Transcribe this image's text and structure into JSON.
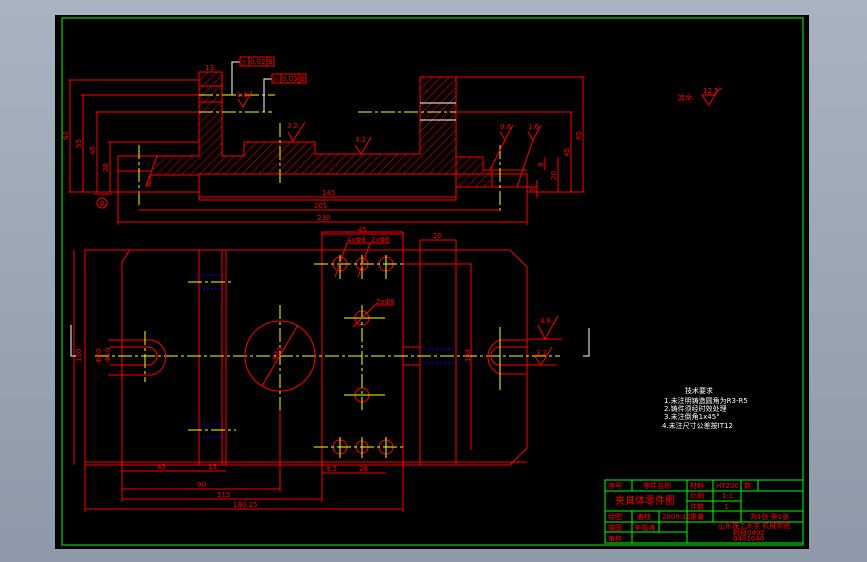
{
  "drawing": {
    "colors": {
      "outline": "#ff0000",
      "centerline": "#ffff00",
      "border": "#00ff00",
      "hidden": "#0000ff",
      "leader": "#ffffff",
      "background": "#000000"
    },
    "top_section": {
      "tolerance_1": {
        "symbol": "//",
        "value": "0.02",
        "datum": "B"
      },
      "tolerance_2": {
        "symbol": "//",
        "value": "0.03",
        "datum": "B"
      },
      "datum_label": "B",
      "dims": {
        "d13": "13",
        "d63": "63",
        "d55": "55",
        "d45": "45",
        "d28": "28",
        "d145": "145",
        "d205": "205",
        "d230": "230",
        "r65": "65",
        "r45": "45",
        "r20": "20",
        "r8": "8",
        "r3": "3"
      },
      "roughness": [
        "0.8",
        "3.2",
        "3.2",
        "0.8",
        "1.6"
      ]
    },
    "plan_view": {
      "dims": {
        "d45top": "45",
        "d20top": "20",
        "holes_4x8": "4xΦ8",
        "holes_2x6": "2xΦ6",
        "holes_2x8": "2xΦ8",
        "d130": "130",
        "d30": "Φ30",
        "d10": "Φ10",
        "d50": "Φ50",
        "d104": "104",
        "d45": "45",
        "d15": "15",
        "d90": "90",
        "d115": "115",
        "d180": "180.25",
        "d95": "9.5",
        "d26": "26"
      },
      "roughness": [
        "4.8",
        "3.2"
      ]
    },
    "general_roughness": {
      "label": "其余",
      "value": "12.5"
    },
    "requirements": {
      "title": "技术要求",
      "items": [
        "1.未注明铸造圆角为R3-R5",
        "2.铸件须经时效处理",
        "3.未注倒角1x45°",
        "4.未注尺寸公差按IT12"
      ]
    },
    "title_block": {
      "seq_label": "序号",
      "part_name_label": "零件名称",
      "material_label": "材料",
      "material": "HT200",
      "qty_short": "数",
      "drawing_name": "夹具体零件图",
      "scale_label": "比例",
      "scale": "1:1",
      "count_label": "件数",
      "count": "1",
      "drawn_label": "绘图",
      "drawn_by": "姜桂",
      "date": "2009.12",
      "weight_label": "重量",
      "sheet": "共1张 第1张",
      "traced_label": "描图",
      "traced_by": "辛福涛",
      "checked_label": "审核",
      "school": "山东理工大学 机械学院",
      "class": "机自0402",
      "student_id": "0401040"
    }
  }
}
